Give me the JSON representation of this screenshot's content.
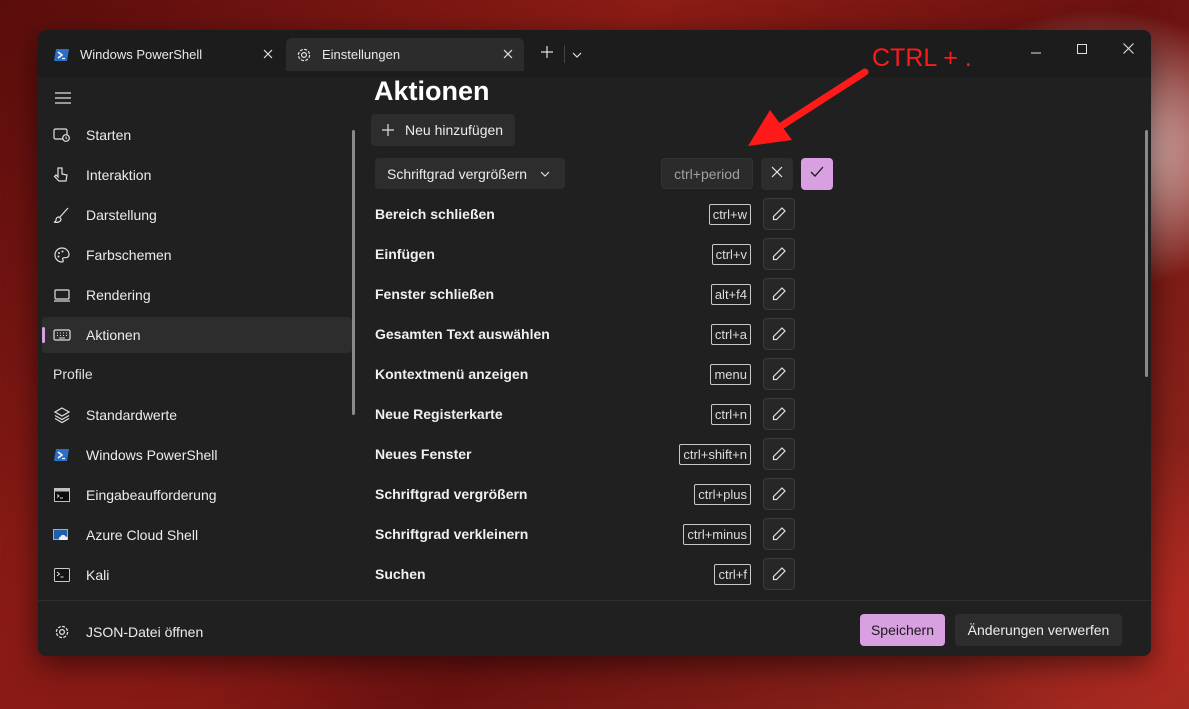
{
  "tabs": [
    {
      "label": "Windows PowerShell",
      "icon": "powershell-icon"
    },
    {
      "label": "Einstellungen",
      "icon": "gear-icon"
    }
  ],
  "sidebar": {
    "items": [
      {
        "label": "Starten",
        "icon": "startup-icon"
      },
      {
        "label": "Interaktion",
        "icon": "pointer-icon"
      },
      {
        "label": "Darstellung",
        "icon": "brush-icon"
      },
      {
        "label": "Farbschemen",
        "icon": "palette-icon"
      },
      {
        "label": "Rendering",
        "icon": "monitor-icon"
      },
      {
        "label": "Aktionen",
        "icon": "keyboard-icon",
        "selected": true
      }
    ],
    "profiles_header": "Profile",
    "profiles": [
      {
        "label": "Standardwerte",
        "icon": "layers-icon"
      },
      {
        "label": "Windows PowerShell",
        "icon": "powershell-icon"
      },
      {
        "label": "Eingabeaufforderung",
        "icon": "cmd-icon"
      },
      {
        "label": "Azure Cloud Shell",
        "icon": "azure-icon"
      },
      {
        "label": "Kali",
        "icon": "linux-icon"
      }
    ],
    "json_link": "JSON-Datei öffnen"
  },
  "main": {
    "title": "Aktionen",
    "add_button": "Neu hinzufügen",
    "editing": {
      "action": "Schriftgrad vergrößern",
      "key_value": "ctrl+period"
    },
    "actions": [
      {
        "name": "Bereich schließen",
        "keys": "ctrl+w"
      },
      {
        "name": "Einfügen",
        "keys": "ctrl+v"
      },
      {
        "name": "Fenster schließen",
        "keys": "alt+f4"
      },
      {
        "name": "Gesamten Text auswählen",
        "keys": "ctrl+a"
      },
      {
        "name": "Kontextmenü anzeigen",
        "keys": "menu"
      },
      {
        "name": "Neue Registerkarte",
        "keys": "ctrl+n"
      },
      {
        "name": "Neues Fenster",
        "keys": "ctrl+shift+n"
      },
      {
        "name": "Schriftgrad vergrößern",
        "keys": "ctrl+plus"
      },
      {
        "name": "Schriftgrad verkleinern",
        "keys": "ctrl+minus"
      },
      {
        "name": "Suchen",
        "keys": "ctrl+f"
      }
    ]
  },
  "footer": {
    "save": "Speichern",
    "discard": "Änderungen verwerfen"
  },
  "annotation": {
    "text": "CTRL + ."
  },
  "colors": {
    "accent": "#d8a0e0",
    "annotation": "#ff1a1a",
    "window_bg": "#202020"
  }
}
